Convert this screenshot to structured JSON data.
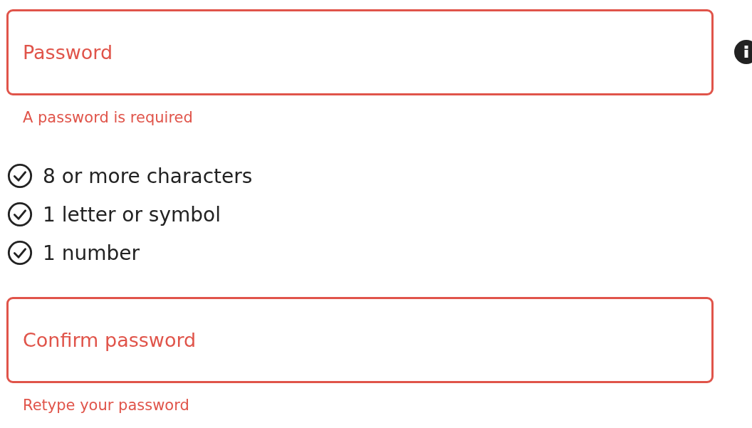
{
  "password_field": {
    "placeholder": "Password",
    "error": true,
    "helper": "A password is required"
  },
  "requirements": [
    {
      "text": "8 or more characters",
      "met": true
    },
    {
      "text": "1 letter or symbol",
      "met": true
    },
    {
      "text": "1 number",
      "met": true
    }
  ],
  "confirm_field": {
    "placeholder": "Confirm password",
    "error": true,
    "helper": "Retype your password"
  }
}
